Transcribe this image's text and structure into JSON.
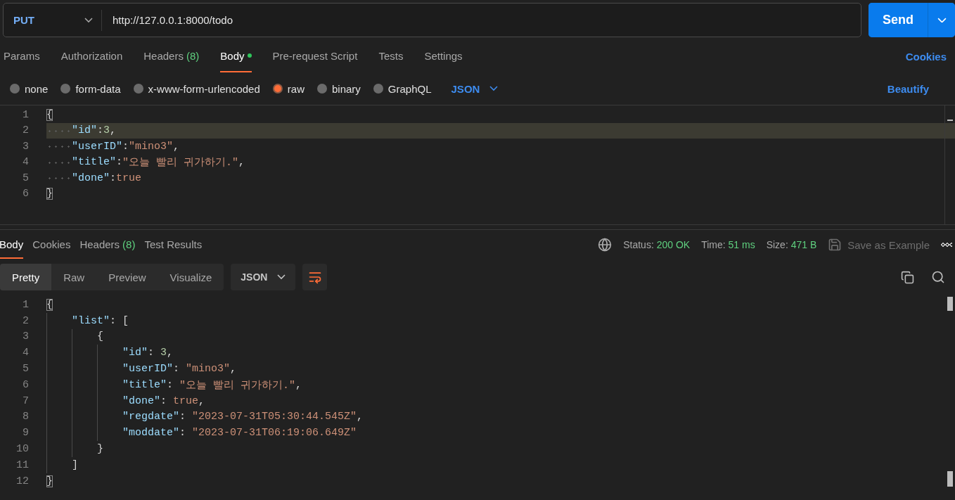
{
  "request": {
    "method": "PUT",
    "url": "http://127.0.0.1:8000/todo",
    "send_label": "Send"
  },
  "request_tabs": [
    {
      "label": "Params",
      "selected": false,
      "dot": false
    },
    {
      "label": "Authorization",
      "selected": false,
      "dot": false
    },
    {
      "label": "Headers",
      "count": "(8)",
      "selected": false,
      "dot": false
    },
    {
      "label": "Body",
      "selected": true,
      "dot": true
    },
    {
      "label": "Pre-request Script",
      "selected": false,
      "dot": false
    },
    {
      "label": "Tests",
      "selected": false,
      "dot": false
    },
    {
      "label": "Settings",
      "selected": false,
      "dot": false
    }
  ],
  "cookies_link": "Cookies",
  "body_types": [
    {
      "label": "none",
      "selected": false
    },
    {
      "label": "form-data",
      "selected": false
    },
    {
      "label": "x-www-form-urlencoded",
      "selected": false
    },
    {
      "label": "raw",
      "selected": true
    },
    {
      "label": "binary",
      "selected": false
    },
    {
      "label": "GraphQL",
      "selected": false
    }
  ],
  "language": "JSON",
  "beautify_link": "Beautify",
  "request_editor": [
    {
      "number": "1",
      "highlighted": false,
      "tokens": [
        {
          "kind": "match",
          "text": "{"
        }
      ]
    },
    {
      "number": "2",
      "highlighted": true,
      "tokens": [
        {
          "kind": "ws"
        },
        {
          "kind": "key",
          "text": "\"id\""
        },
        {
          "kind": "punct",
          "text": ":"
        },
        {
          "kind": "number",
          "text": "3"
        },
        {
          "kind": "punct",
          "text": ","
        }
      ]
    },
    {
      "number": "3",
      "highlighted": false,
      "tokens": [
        {
          "kind": "ws"
        },
        {
          "kind": "key",
          "text": "\"userID\""
        },
        {
          "kind": "punct",
          "text": ":"
        },
        {
          "kind": "string",
          "text": "\"mino3\""
        },
        {
          "kind": "punct",
          "text": ","
        }
      ]
    },
    {
      "number": "4",
      "highlighted": false,
      "tokens": [
        {
          "kind": "ws"
        },
        {
          "kind": "key",
          "text": "\"title\""
        },
        {
          "kind": "punct",
          "text": ":"
        },
        {
          "kind": "string",
          "text": "\"오늘 빨리 귀가하기.\""
        },
        {
          "kind": "punct",
          "text": ","
        }
      ]
    },
    {
      "number": "5",
      "highlighted": false,
      "tokens": [
        {
          "kind": "ws"
        },
        {
          "kind": "key",
          "text": "\"done\""
        },
        {
          "kind": "punct",
          "text": ":"
        },
        {
          "kind": "bool",
          "text": "true"
        }
      ]
    },
    {
      "number": "6",
      "highlighted": false,
      "tokens": [
        {
          "kind": "match",
          "text": "}"
        }
      ]
    }
  ],
  "response_tabs": [
    {
      "label": "Body",
      "selected": true
    },
    {
      "label": "Cookies",
      "selected": false
    },
    {
      "label": "Headers",
      "count": "(8)",
      "selected": false
    },
    {
      "label": "Test Results",
      "selected": false
    }
  ],
  "response_meta": [
    {
      "label": "Status:",
      "value": "200 OK"
    },
    {
      "label": "Time:",
      "value": "51 ms"
    },
    {
      "label": "Size:",
      "value": "471 B"
    }
  ],
  "save_example": "Save as Example",
  "view_modes": [
    {
      "label": "Pretty",
      "selected": true
    },
    {
      "label": "Raw",
      "selected": false
    },
    {
      "label": "Preview",
      "selected": false
    },
    {
      "label": "Visualize",
      "selected": false
    }
  ],
  "response_language": "JSON",
  "response_editor": [
    {
      "number": "1",
      "tokens": [
        {
          "kind": "match",
          "text": "{"
        }
      ]
    },
    {
      "number": "2",
      "tokens": [
        {
          "kind": "guide"
        },
        {
          "kind": "key",
          "text": "\"list\""
        },
        {
          "kind": "punct",
          "text": ": ["
        }
      ]
    },
    {
      "number": "3",
      "tokens": [
        {
          "kind": "guide"
        },
        {
          "kind": "guide"
        },
        {
          "kind": "punct",
          "text": "{"
        }
      ]
    },
    {
      "number": "4",
      "tokens": [
        {
          "kind": "guide"
        },
        {
          "kind": "guide"
        },
        {
          "kind": "guide"
        },
        {
          "kind": "key",
          "text": "\"id\""
        },
        {
          "kind": "punct",
          "text": ": "
        },
        {
          "kind": "number",
          "text": "3"
        },
        {
          "kind": "punct",
          "text": ","
        }
      ]
    },
    {
      "number": "5",
      "tokens": [
        {
          "kind": "guide"
        },
        {
          "kind": "guide"
        },
        {
          "kind": "guide"
        },
        {
          "kind": "key",
          "text": "\"userID\""
        },
        {
          "kind": "punct",
          "text": ": "
        },
        {
          "kind": "string",
          "text": "\"mino3\""
        },
        {
          "kind": "punct",
          "text": ","
        }
      ]
    },
    {
      "number": "6",
      "tokens": [
        {
          "kind": "guide"
        },
        {
          "kind": "guide"
        },
        {
          "kind": "guide"
        },
        {
          "kind": "key",
          "text": "\"title\""
        },
        {
          "kind": "punct",
          "text": ": "
        },
        {
          "kind": "string",
          "text": "\"오늘 빨리 귀가하기.\""
        },
        {
          "kind": "punct",
          "text": ","
        }
      ]
    },
    {
      "number": "7",
      "tokens": [
        {
          "kind": "guide"
        },
        {
          "kind": "guide"
        },
        {
          "kind": "guide"
        },
        {
          "kind": "key",
          "text": "\"done\""
        },
        {
          "kind": "punct",
          "text": ": "
        },
        {
          "kind": "bool",
          "text": "true"
        },
        {
          "kind": "punct",
          "text": ","
        }
      ]
    },
    {
      "number": "8",
      "tokens": [
        {
          "kind": "guide"
        },
        {
          "kind": "guide"
        },
        {
          "kind": "guide"
        },
        {
          "kind": "key",
          "text": "\"regdate\""
        },
        {
          "kind": "punct",
          "text": ": "
        },
        {
          "kind": "string",
          "text": "\"2023-07-31T05:30:44.545Z\""
        },
        {
          "kind": "punct",
          "text": ","
        }
      ]
    },
    {
      "number": "9",
      "tokens": [
        {
          "kind": "guide"
        },
        {
          "kind": "guide"
        },
        {
          "kind": "guide"
        },
        {
          "kind": "key",
          "text": "\"moddate\""
        },
        {
          "kind": "punct",
          "text": ": "
        },
        {
          "kind": "string",
          "text": "\"2023-07-31T06:19:06.649Z\""
        }
      ]
    },
    {
      "number": "10",
      "tokens": [
        {
          "kind": "guide"
        },
        {
          "kind": "guide"
        },
        {
          "kind": "punct",
          "text": "}"
        }
      ]
    },
    {
      "number": "11",
      "tokens": [
        {
          "kind": "guide"
        },
        {
          "kind": "punct",
          "text": "]"
        }
      ]
    },
    {
      "number": "12",
      "tokens": [
        {
          "kind": "match",
          "text": "}"
        }
      ]
    }
  ]
}
